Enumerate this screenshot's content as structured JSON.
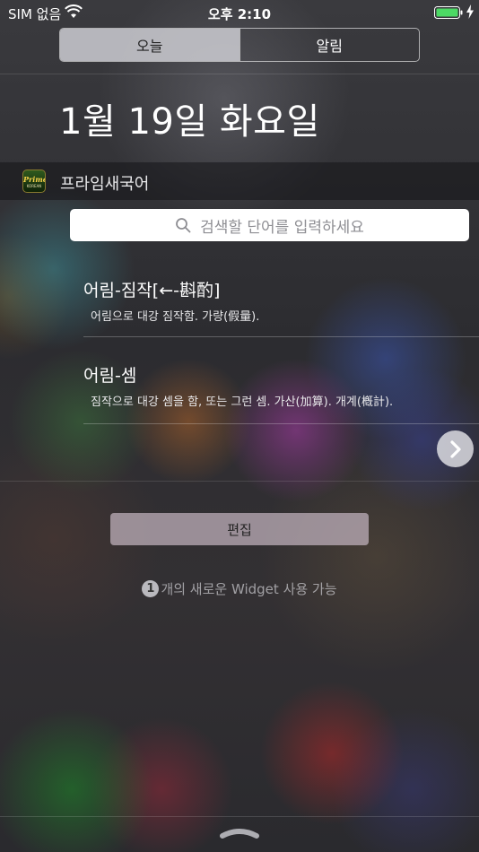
{
  "status_bar": {
    "carrier": "SIM 없음",
    "time": "오후 2:10",
    "battery_color": "#4cd964"
  },
  "segment": {
    "tabs": [
      {
        "label": "오늘",
        "active": true
      },
      {
        "label": "알림",
        "active": false
      }
    ]
  },
  "date_title": "1월 19일 화요일",
  "widget": {
    "app_name": "프라임새국어",
    "app_icon_text": "Prime",
    "app_icon_subtext": "KOREAN",
    "search_placeholder": "검색할 단어를 입력하세요",
    "results": [
      {
        "term": "어림-짐작[←-斟酌]",
        "definition": "어림으로 대강 짐작함. 가량(假量)."
      },
      {
        "term": "어림-셈",
        "definition": "짐작으로 대강 셈을 함, 또는 그런 셈. 가산(加算). 개계(槪計)."
      }
    ]
  },
  "edit_label": "편집",
  "notice": {
    "count": "1",
    "text": "개의 새로운 Widget 사용 가능"
  },
  "icons": {
    "wifi": "wifi-icon",
    "battery": "battery-icon",
    "charging": "bolt-icon",
    "search": "search-icon",
    "next": "chevron-right-icon",
    "grabber": "grabber-icon"
  }
}
